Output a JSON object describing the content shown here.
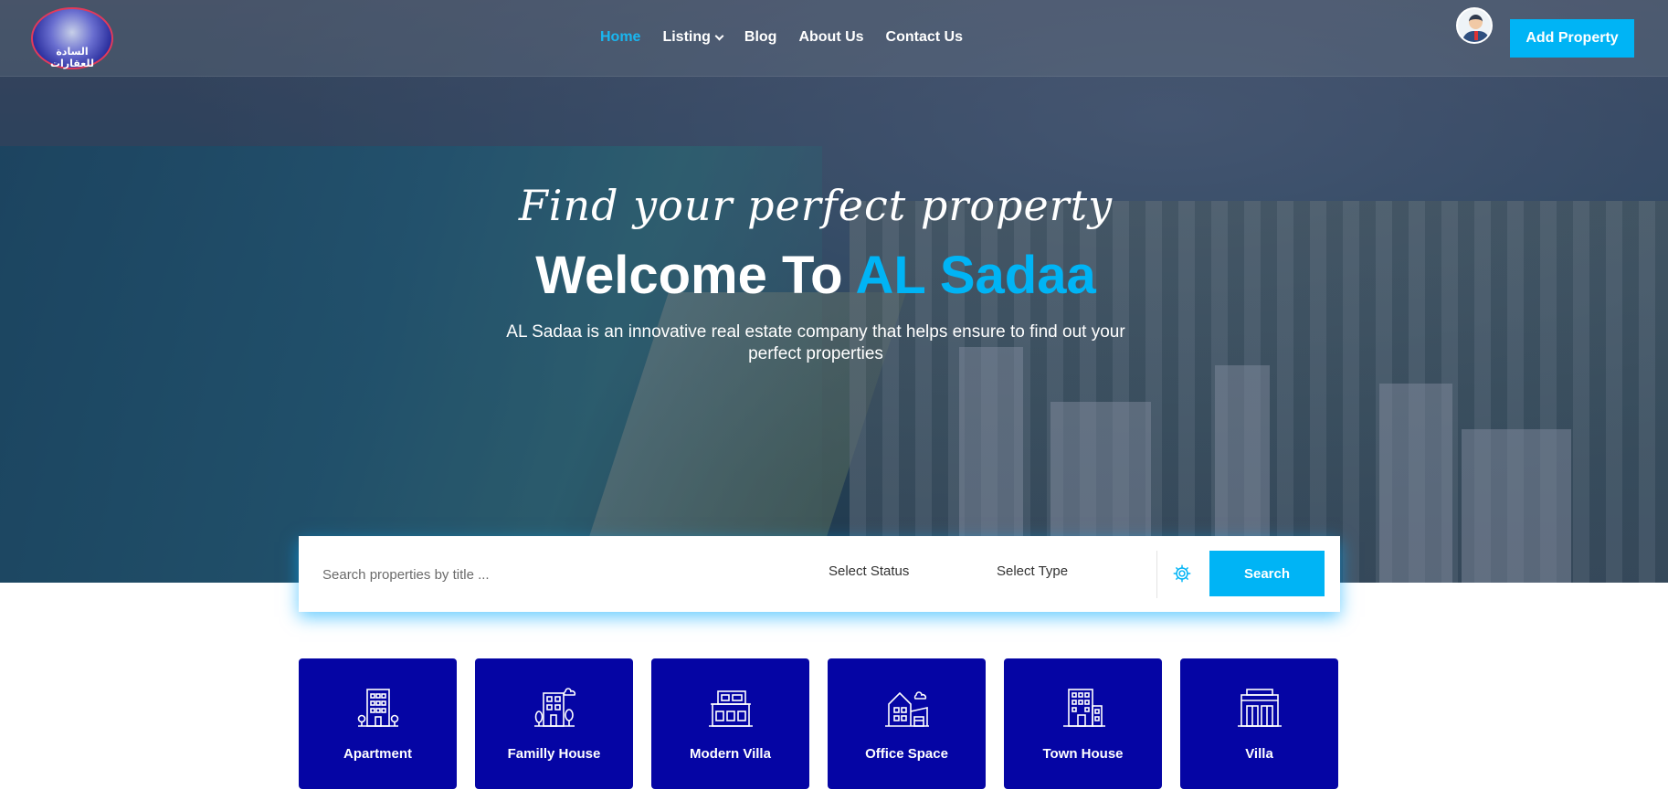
{
  "nav": {
    "logo_text": "السادة للعقارات",
    "links": [
      {
        "label": "Home",
        "active": true
      },
      {
        "label": "Listing",
        "has_dropdown": true
      },
      {
        "label": "Blog"
      },
      {
        "label": "About Us"
      },
      {
        "label": "Contact Us"
      }
    ],
    "add_property_label": "Add Property"
  },
  "hero": {
    "tagline": "Find your perfect property",
    "welcome_prefix": "Welcome To ",
    "brand_name": "AL Sadaa",
    "subtitle": "AL Sadaa is an innovative real estate company that helps ensure to find out your perfect properties"
  },
  "search": {
    "placeholder": "Search properties by title ...",
    "status_label": "Select Status",
    "type_label": "Select Type",
    "button_label": "Search"
  },
  "categories": [
    {
      "label": "Apartment",
      "icon": "apartment-icon"
    },
    {
      "label": "Familly House",
      "icon": "family-house-icon"
    },
    {
      "label": "Modern Villa",
      "icon": "modern-villa-icon"
    },
    {
      "label": "Office Space",
      "icon": "office-space-icon"
    },
    {
      "label": "Town House",
      "icon": "town-house-icon"
    },
    {
      "label": "Villa",
      "icon": "villa-icon"
    }
  ],
  "colors": {
    "accent": "#00b4f5",
    "category_bg": "#0505a4"
  }
}
